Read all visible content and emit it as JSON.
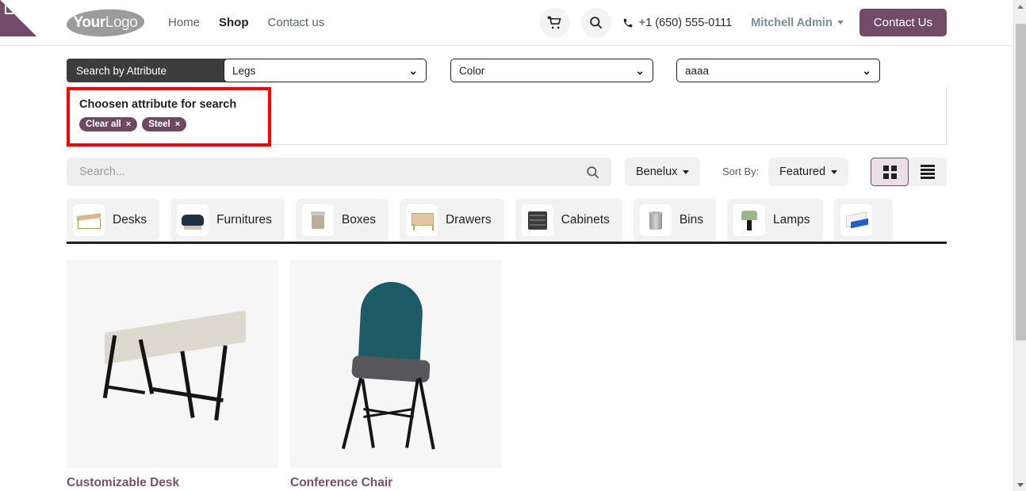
{
  "brand": {
    "accent": "#714B67",
    "logo_bold": "Your",
    "logo_light": "Logo",
    "logo_name": "yourlogo"
  },
  "header": {
    "nav": [
      {
        "label": "Home",
        "active": false
      },
      {
        "label": "Shop",
        "active": true
      },
      {
        "label": "Contact us",
        "active": false
      }
    ],
    "cart_icon": "shopping-cart-icon",
    "search_icon": "search-icon",
    "phone_icon": "phone-icon",
    "phone": "+1 (650) 555-0111",
    "user": "Mitchell Admin",
    "contact_button": "Contact Us"
  },
  "attribute_filter": {
    "panel_title": "Search by Attribute",
    "collapse_icon": "minus-icon",
    "selects": [
      {
        "name": "legs",
        "value": "Legs"
      },
      {
        "name": "color",
        "value": "Color"
      },
      {
        "name": "aaaa",
        "value": "aaaa"
      }
    ],
    "chosen": {
      "title": "Choosen attribute for search",
      "highlight_color": "#ff0000",
      "tags": [
        {
          "label": "Clear all",
          "remove": "×"
        },
        {
          "label": "Steel",
          "remove": "×"
        }
      ]
    }
  },
  "toolbar": {
    "search_placeholder": "Search...",
    "search_value": "",
    "search_icon": "search-icon",
    "pricelist": "Benelux",
    "sort_label": "Sort By:",
    "sort_value": "Featured",
    "view_grid_icon": "grid-view-icon",
    "view_list_icon": "list-view-icon",
    "active_view": "grid"
  },
  "categories": [
    {
      "label": "Desks",
      "thumb": "desk-thumbnail"
    },
    {
      "label": "Furnitures",
      "thumb": "sofa-thumbnail"
    },
    {
      "label": "Boxes",
      "thumb": "box-thumbnail"
    },
    {
      "label": "Drawers",
      "thumb": "drawer-thumbnail"
    },
    {
      "label": "Cabinets",
      "thumb": "cabinet-thumbnail"
    },
    {
      "label": "Bins",
      "thumb": "bin-thumbnail"
    },
    {
      "label": "Lamps",
      "thumb": "lamp-thumbnail"
    },
    {
      "label": "",
      "thumb": "blue-product-thumbnail"
    }
  ],
  "products": [
    {
      "name": "Customizable Desk",
      "image": "customizable-desk-photo"
    },
    {
      "name": "Conference Chair",
      "image": "conference-chair-photo"
    }
  ],
  "scrollbar": {
    "up": "scroll-up-arrow",
    "down": "scroll-down-arrow"
  }
}
